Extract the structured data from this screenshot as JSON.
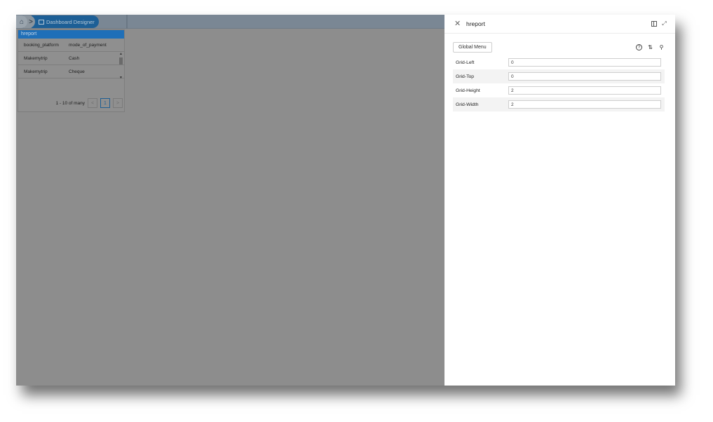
{
  "breadcrumb": {
    "home_icon": "home-icon",
    "separator": ">",
    "active_label": "Dashboard Designer"
  },
  "report": {
    "title": "hreport",
    "columns": [
      "booking_platform",
      "mode_of_payment"
    ],
    "rows": [
      [
        "Makemytrip",
        "Cash"
      ],
      [
        "Makemytrip",
        "Cheque"
      ]
    ],
    "pager": {
      "summary": "1 - 10 of many",
      "prev": "<",
      "current_page": "1",
      "next": ">"
    }
  },
  "drawer": {
    "title": "hreport",
    "close_glyph": "✕",
    "expand_glyph": "⤢",
    "global_menu_label": "Global Menu",
    "help_glyph": "?",
    "sort_glyph": "⇅",
    "search_glyph": "⚲",
    "properties": [
      {
        "label": "Grid-Left",
        "value": "0"
      },
      {
        "label": "Grid-Top",
        "value": "0"
      },
      {
        "label": "Grid-Height",
        "value": "2"
      },
      {
        "label": "Grid-Width",
        "value": "2"
      }
    ]
  },
  "colors": {
    "accent": "#1f6fb8",
    "overlay": "#8a8a8a"
  }
}
